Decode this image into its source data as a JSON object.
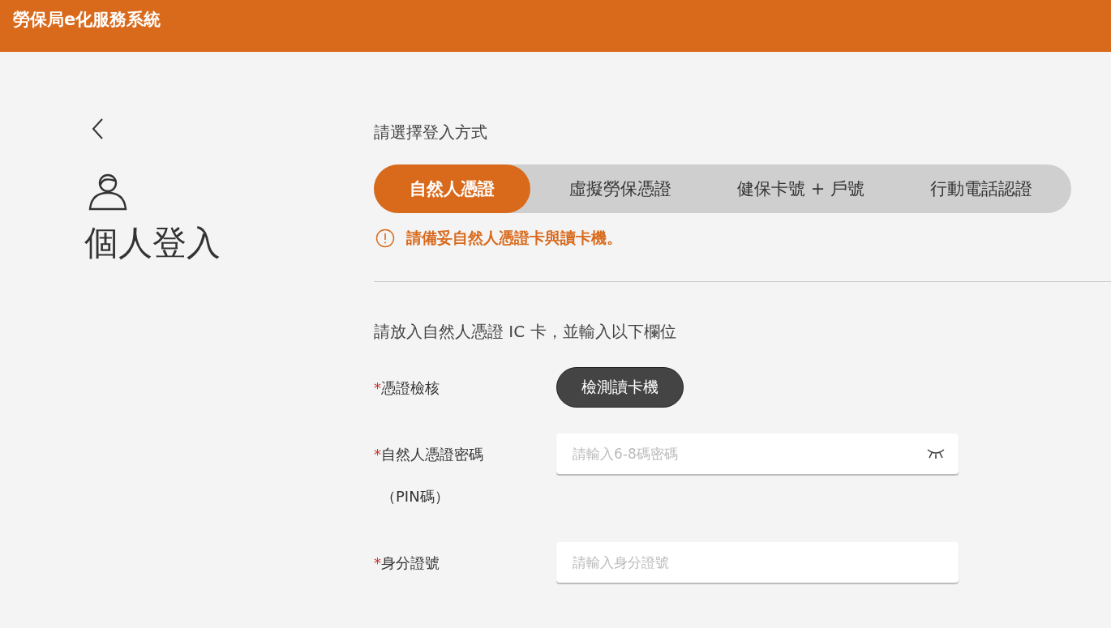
{
  "header": {
    "title": "勞保局e化服務系統"
  },
  "page": {
    "title": "個人登入"
  },
  "login": {
    "prompt": "請選擇登入方式",
    "tabs": [
      {
        "label": "自然人憑證",
        "selected": true
      },
      {
        "label": "虛擬勞保憑證",
        "selected": false
      },
      {
        "label": "健保卡號 + 戶號",
        "selected": false
      },
      {
        "label": "行動電話認證",
        "selected": false
      }
    ],
    "notice": "請備妥自然人憑證卡與讀卡機。",
    "instruction": "請放入自然人憑證 IC 卡，並輸入以下欄位",
    "fields": [
      {
        "kind": "button",
        "label": "憑證檢核",
        "required_mark": "*",
        "button": "檢測讀卡機"
      },
      {
        "kind": "password",
        "label": "自然人憑證密碼（PIN碼）",
        "required_mark": "*",
        "placeholder": "請輸入6-8碼密碼"
      },
      {
        "kind": "text",
        "label": "身分證號",
        "required_mark": "*",
        "placeholder": "請輸入身分證號"
      }
    ]
  }
}
